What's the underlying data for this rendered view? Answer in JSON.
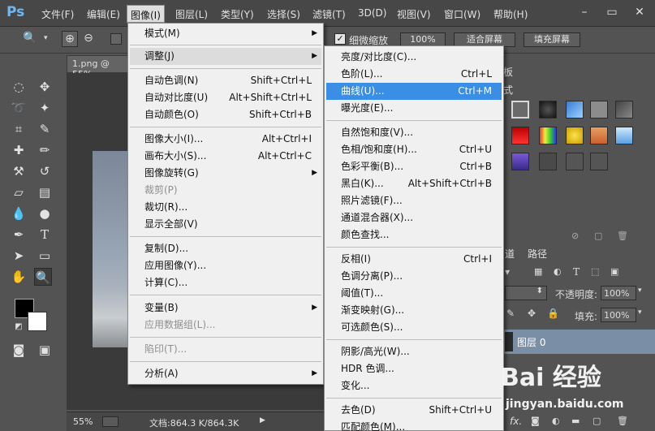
{
  "app": {
    "logo": "Ps"
  },
  "menubar": {
    "items": [
      {
        "label": "文件(F)"
      },
      {
        "label": "编辑(E)"
      },
      {
        "label": "图像(I)"
      },
      {
        "label": "图层(L)"
      },
      {
        "label": "类型(Y)"
      },
      {
        "label": "选择(S)"
      },
      {
        "label": "滤镜(T)"
      },
      {
        "label": "3D(D)"
      },
      {
        "label": "视图(V)"
      },
      {
        "label": "窗口(W)"
      },
      {
        "label": "帮助(H)"
      }
    ],
    "window_buttons": {
      "minimize": "–",
      "maximize": "▭",
      "close": "✕"
    }
  },
  "options_bar": {
    "fine_zoom_label": "细微缩放",
    "fine_zoom_checked": true,
    "zoom_value": "100%",
    "fit_screen": "适合屏幕",
    "fill_screen": "填充屏幕"
  },
  "document": {
    "tab": "1.png @ 55%",
    "zoom": "55%",
    "doc_info": "文档:864.3 K/864.3K"
  },
  "image_menu": {
    "items": [
      {
        "label": "模式(M)",
        "shortcut": "",
        "submenu": true,
        "disabled": false
      },
      {
        "label": "调整(J)",
        "shortcut": "",
        "submenu": true,
        "disabled": false,
        "highlight": true
      },
      {
        "label": "自动色调(N)",
        "shortcut": "Shift+Ctrl+L"
      },
      {
        "label": "自动对比度(U)",
        "shortcut": "Alt+Shift+Ctrl+L"
      },
      {
        "label": "自动颜色(O)",
        "shortcut": "Shift+Ctrl+B"
      },
      {
        "label": "图像大小(I)...",
        "shortcut": "Alt+Ctrl+I"
      },
      {
        "label": "画布大小(S)...",
        "shortcut": "Alt+Ctrl+C"
      },
      {
        "label": "图像旋转(G)",
        "shortcut": "",
        "submenu": true
      },
      {
        "label": "裁剪(P)",
        "shortcut": "",
        "disabled": true
      },
      {
        "label": "裁切(R)...",
        "shortcut": ""
      },
      {
        "label": "显示全部(V)",
        "shortcut": ""
      },
      {
        "label": "复制(D)...",
        "shortcut": ""
      },
      {
        "label": "应用图像(Y)...",
        "shortcut": ""
      },
      {
        "label": "计算(C)...",
        "shortcut": ""
      },
      {
        "label": "变量(B)",
        "shortcut": "",
        "submenu": true
      },
      {
        "label": "应用数据组(L)...",
        "shortcut": "",
        "disabled": true
      },
      {
        "label": "陷印(T)...",
        "shortcut": "",
        "disabled": true
      },
      {
        "label": "分析(A)",
        "shortcut": "",
        "submenu": true
      }
    ]
  },
  "adjust_menu": {
    "items": [
      {
        "label": "亮度/对比度(C)...",
        "shortcut": ""
      },
      {
        "label": "色阶(L)...",
        "shortcut": "Ctrl+L"
      },
      {
        "label": "曲线(U)...",
        "shortcut": "Ctrl+M",
        "highlight": true
      },
      {
        "label": "曝光度(E)...",
        "shortcut": ""
      },
      {
        "label": "自然饱和度(V)...",
        "shortcut": ""
      },
      {
        "label": "色相/饱和度(H)...",
        "shortcut": "Ctrl+U"
      },
      {
        "label": "色彩平衡(B)...",
        "shortcut": "Ctrl+B"
      },
      {
        "label": "黑白(K)...",
        "shortcut": "Alt+Shift+Ctrl+B"
      },
      {
        "label": "照片滤镜(F)...",
        "shortcut": ""
      },
      {
        "label": "通道混合器(X)...",
        "shortcut": ""
      },
      {
        "label": "颜色查找...",
        "shortcut": ""
      },
      {
        "label": "反相(I)",
        "shortcut": "Ctrl+I"
      },
      {
        "label": "色调分离(P)...",
        "shortcut": ""
      },
      {
        "label": "阈值(T)...",
        "shortcut": ""
      },
      {
        "label": "渐变映射(G)...",
        "shortcut": ""
      },
      {
        "label": "可选颜色(S)...",
        "shortcut": ""
      },
      {
        "label": "阴影/高光(W)...",
        "shortcut": ""
      },
      {
        "label": "HDR 色调...",
        "shortcut": ""
      },
      {
        "label": "变化...",
        "shortcut": ""
      },
      {
        "label": "去色(D)",
        "shortcut": "Shift+Ctrl+U"
      },
      {
        "label": "匹配颜色(M)...",
        "shortcut": ""
      }
    ]
  },
  "panels": {
    "styles_tab_partial": "式",
    "board_tab_partial": "板",
    "channels_tab_partial": "道",
    "paths_tab": "路径",
    "opacity_label": "不透明度:",
    "opacity_value": "100%",
    "fill_label": "填充:",
    "fill_value": "100%",
    "layer_name": "图层 0",
    "fx_label": "fx."
  },
  "watermark": {
    "main": "Bai 经验",
    "sub": "jingyan.baidu.com"
  }
}
